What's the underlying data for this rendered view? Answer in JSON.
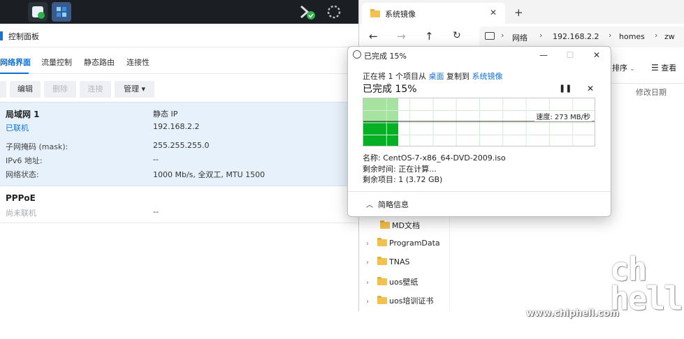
{
  "dsm": {
    "panel_title": "控制面板",
    "tabs": [
      "网络界面",
      "流量控制",
      "静态路由",
      "连接性"
    ],
    "toolbar": {
      "edit": "编辑",
      "delete": "删除",
      "connect": "连接",
      "manage": "管理 ▾"
    },
    "lan": {
      "name": "局域网 1",
      "status": "已联机",
      "type": "静态 IP",
      "ip": "192.168.2.2",
      "rows": [
        {
          "label": "子网掩码 (mask):",
          "value": "255.255.255.0"
        },
        {
          "label": "IPv6 地址:",
          "value": "--"
        },
        {
          "label": "网络状态:",
          "value": "1000 Mb/s, 全双工, MTU 1500"
        }
      ]
    },
    "pppoe": {
      "name": "PPPoE",
      "status": "尚未联机",
      "value": "--"
    }
  },
  "explorer": {
    "tab_title": "系统镜像",
    "new_tab": "+",
    "address": [
      "网络",
      "192.168.2.2",
      "homes",
      "zw"
    ],
    "sort": "排序",
    "view": "查看",
    "column_modified": "修改日期",
    "tree": [
      "MD文档",
      "ProgramData",
      "TNAS",
      "uos壁纸",
      "uos培训证书"
    ]
  },
  "dialog": {
    "title": "已完成 15%",
    "from_line": {
      "prefix": "正在将 1 个项目从 ",
      "source": "桌面",
      "mid": " 复制到 ",
      "target": "系统镜像"
    },
    "heading": "已完成 15%",
    "progress": 0.15,
    "speed": "速度: 273 MB/秒",
    "name_line": "名称: CentOS-7-x86_64-DVD-2009.iso",
    "time_line": "剩余时间: 正在计算...",
    "items_line": "剩余项目: 1 (3.72 GB)",
    "less_info": "简略信息"
  },
  "watermark": {
    "logo": "chip hell",
    "site": "www.chiphell.com"
  },
  "colors": {
    "accent": "#1a73d1",
    "progress_green": "#06b025",
    "progress_green_light": "#a6e3a1",
    "taskbar": "#1b1f24"
  }
}
